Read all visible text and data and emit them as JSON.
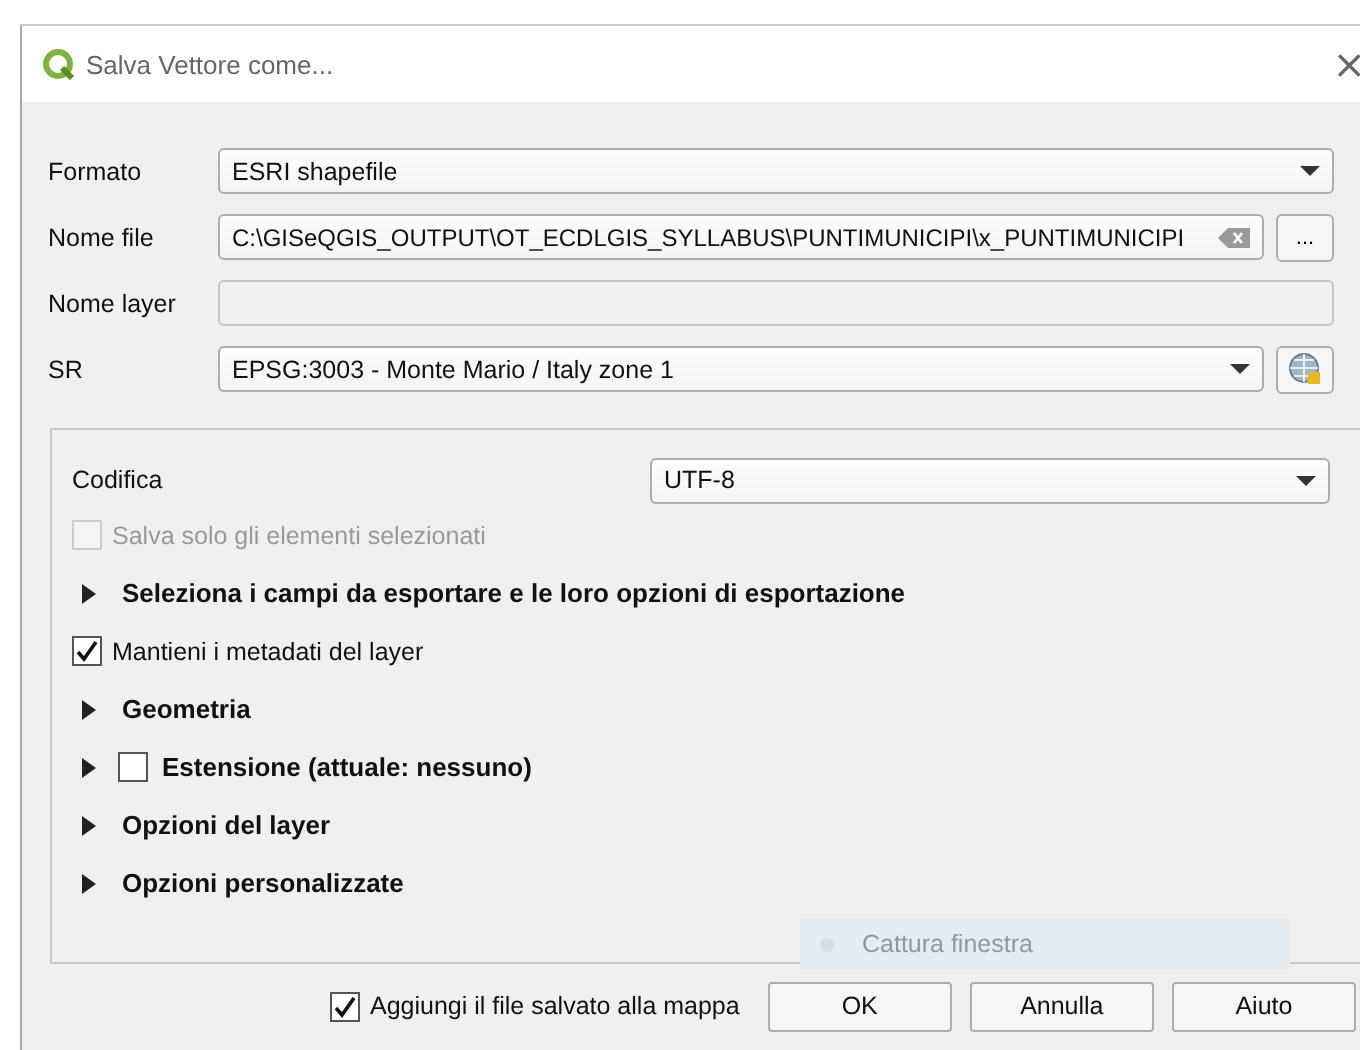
{
  "window": {
    "title": "Salva Vettore come...",
    "close": "×"
  },
  "form": [
    {
      "kind": "combo",
      "label": "Formato",
      "value": "ESRI shapefile"
    },
    {
      "kind": "file",
      "label": "Nome file",
      "value": "C:\\GISeQGIS_OUTPUT\\OT_ECDLGIS_SYLLABUS\\PUNTIMUNICIPI\\x_PUNTIMUNICIPI",
      "browse": "..."
    },
    {
      "kind": "text",
      "label": "Nome layer",
      "disabled": true
    },
    {
      "kind": "crs",
      "label": "SR",
      "value": "EPSG:3003 - Monte Mario / Italy zone 1"
    }
  ],
  "encoding": {
    "label": "Codifica",
    "value": "UTF-8"
  },
  "options": [
    {
      "kind": "checkbox",
      "label": "Salva solo gli elementi selezionati",
      "checked": false,
      "disabled": true
    },
    {
      "kind": "section",
      "label": "Seleziona i campi da esportare e le loro opzioni di esportazione",
      "expanded": false
    },
    {
      "kind": "checkbox",
      "label": "Mantieni i metadati del layer",
      "checked": true,
      "disabled": false
    },
    {
      "kind": "section",
      "label": "Geometria",
      "expanded": false
    },
    {
      "kind": "section",
      "label": "Estensione (attuale: nessuno)",
      "expanded": false,
      "checked": false
    },
    {
      "kind": "section",
      "label": "Opzioni del layer",
      "expanded": false
    },
    {
      "kind": "section",
      "label": "Opzioni personalizzate",
      "expanded": false
    }
  ],
  "overlay_hint": "Cattura finestra",
  "footer": {
    "add_to_map": {
      "label": "Aggiungi il file salvato alla mappa",
      "checked": true
    },
    "buttons": [
      "OK",
      "Annulla",
      "Aiuto"
    ]
  }
}
